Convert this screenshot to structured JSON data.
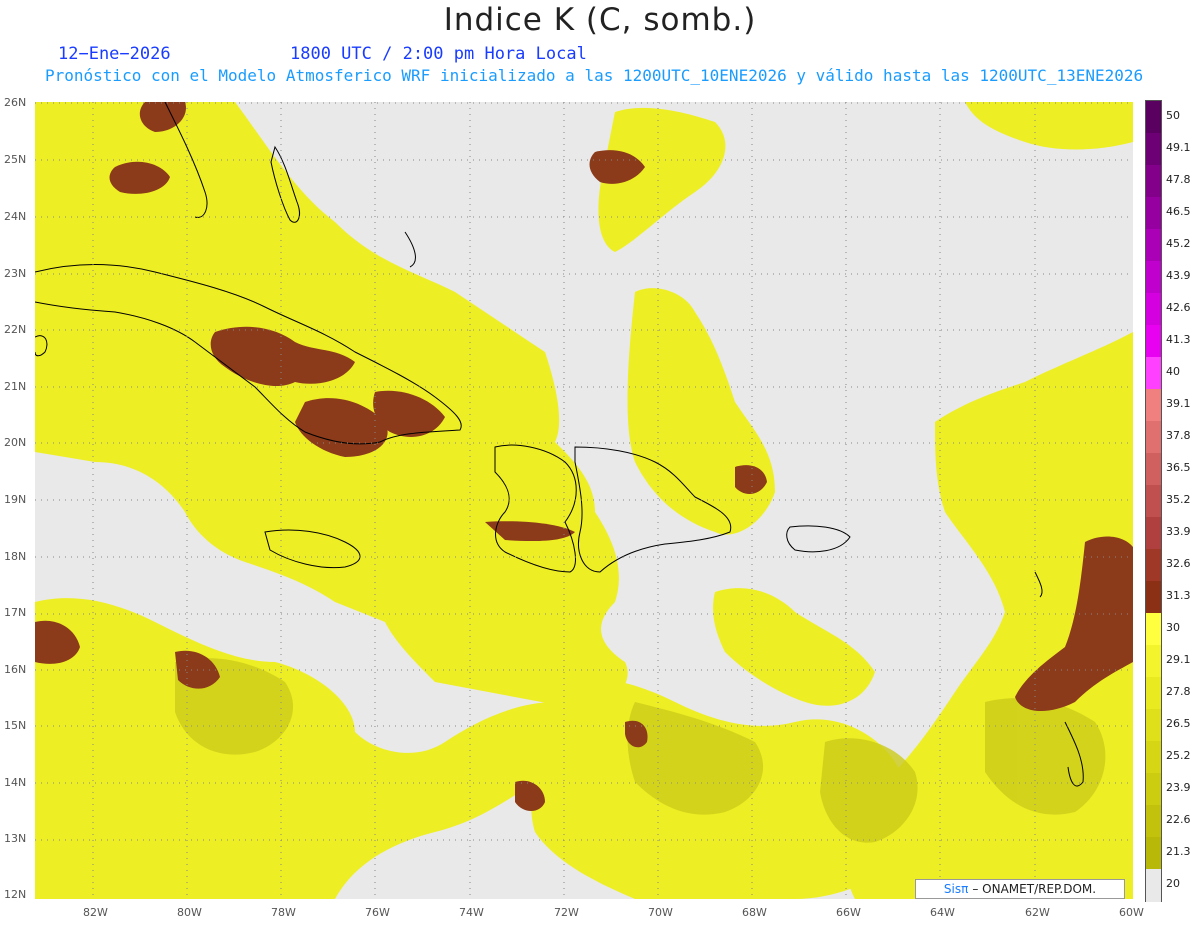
{
  "title": "Indice K (C, somb.)",
  "date": "12−Ene−2026",
  "time": "1800 UTC / 2:00 pm Hora Local",
  "subtitle": "Pronóstico con el Modelo Atmosferico WRF inicializado a las 1200UTC_10ENE2026 y válido hasta las  1200UTC_13ENE2026",
  "credit": {
    "logo": "Sisπ",
    "text": "–  ONAMET/REP.DOM."
  },
  "map": {
    "extent": {
      "lon": [
        -83.2,
        -60.0
      ],
      "lat": [
        12.0,
        26.0
      ]
    },
    "lat_labels": [
      "26N",
      "25N",
      "24N",
      "23N",
      "22N",
      "21N",
      "20N",
      "19N",
      "18N",
      "17N",
      "16N",
      "15N",
      "14N",
      "13N",
      "12N"
    ],
    "lon_labels": [
      "82W",
      "80W",
      "78W",
      "76W",
      "74W",
      "72W",
      "70W",
      "68W",
      "66W",
      "64W",
      "62W",
      "60W"
    ],
    "colors": {
      "background": "#e9e9e9",
      "low": "#d8d820",
      "mid": "#f0f028",
      "high": "#8b3a1a",
      "coast": "#000000",
      "grid": "#888888"
    }
  },
  "legend": {
    "labels": [
      "50",
      "49.1",
      "47.8",
      "46.5",
      "45.2",
      "43.9",
      "42.6",
      "41.3",
      "40",
      "39.1",
      "37.8",
      "36.5",
      "35.2",
      "33.9",
      "32.6",
      "31.3",
      "30",
      "29.1",
      "27.8",
      "26.5",
      "25.2",
      "23.9",
      "22.6",
      "21.3",
      "20"
    ],
    "colors": [
      "#5a0060",
      "#6e0075",
      "#82008a",
      "#9600a0",
      "#aa00b6",
      "#c000cc",
      "#d400e0",
      "#e800f0",
      "#ff40ff",
      "#f08080",
      "#e07070",
      "#d06060",
      "#c05050",
      "#b04040",
      "#a03828",
      "#8b3015",
      "#ffff40",
      "#f4f42c",
      "#eaea20",
      "#e0e01a",
      "#d6d614",
      "#cccc10",
      "#c2c20c",
      "#b8b808",
      "#e9e9e9"
    ]
  }
}
